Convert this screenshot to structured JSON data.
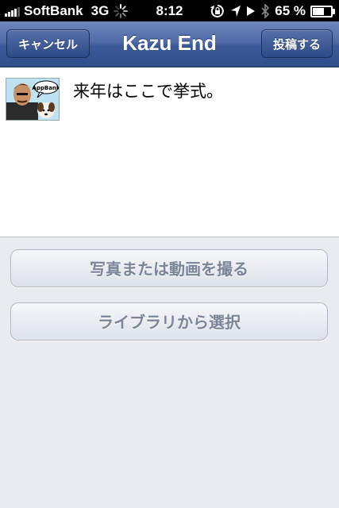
{
  "status_bar": {
    "carrier": "SoftBank",
    "network": "3G",
    "time": "8:12",
    "battery": "65 %",
    "battery_level": 0.65
  },
  "nav_bar": {
    "title": "Kazu End",
    "cancel_label": "キャンセル",
    "post_label": "投稿する",
    "colors": {
      "bar": "#3b5998"
    }
  },
  "composer": {
    "text": "来年はここで挙式。",
    "avatar_badge": "AppBank"
  },
  "actions": {
    "camera_label": "写真または動画を撮る",
    "library_label": "ライブラリから選択"
  }
}
